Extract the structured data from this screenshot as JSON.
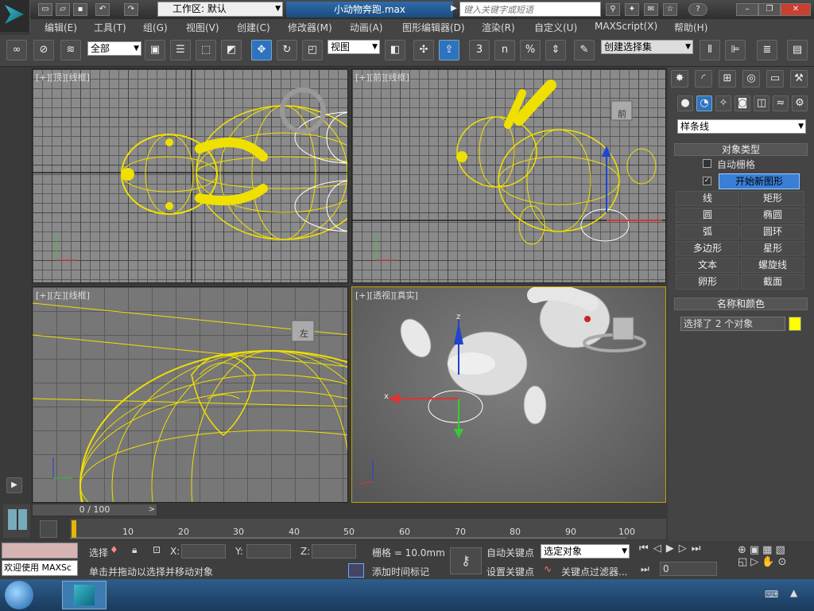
{
  "title_bar": {
    "workspace_label": "工作区: 默认",
    "file_title": "小动物奔跑.max",
    "search_placeholder": "键入关键字或短语",
    "help_icon": "?"
  },
  "menu": [
    "编辑(E)",
    "工具(T)",
    "组(G)",
    "视图(V)",
    "创建(C)",
    "修改器(M)",
    "动画(A)",
    "图形编辑器(D)",
    "渲染(R)",
    "自定义(U)",
    "MAXScript(X)",
    "帮助(H)"
  ],
  "toolbar": {
    "selection_filter": "全部",
    "reference_coord": "视图",
    "named_selection": "创建选择集",
    "snap_value": "3",
    "percent_label": "%",
    "angle_label": "n"
  },
  "viewports": [
    {
      "label": "[+][顶][线框]"
    },
    {
      "label": "[+][前][线框]"
    },
    {
      "label": "[+][左][线框]"
    },
    {
      "label": "[+][透视][真实]"
    }
  ],
  "viewcube_labels": {
    "front": "前",
    "left": "左"
  },
  "command_panel": {
    "category": "样条线",
    "object_type_title": "对象类型",
    "auto_grid": "自动栅格",
    "start_new_shape": "开始新图形",
    "buttons": [
      "线",
      "矩形",
      "圆",
      "椭圆",
      "弧",
      "圆环",
      "多边形",
      "星形",
      "文本",
      "螺旋线",
      "卵形",
      "截面"
    ],
    "name_color_title": "名称和颜色",
    "selection_text": "选择了 2 个对象",
    "object_color": "#ffff00"
  },
  "time": {
    "slider": "0 / 100",
    "ticks": [
      "10",
      "20",
      "30",
      "40",
      "50",
      "60",
      "70",
      "80",
      "90",
      "100"
    ]
  },
  "status": {
    "welcome": "欢迎使用 MAXSc",
    "select_label": "选择",
    "x_label": "X:",
    "y_label": "Y:",
    "z_label": "Z:",
    "grid": "栅格 = 10.0mm",
    "prompt": "单击并拖动以选择并移动对象",
    "add_time_tag": "添加时间标记",
    "auto_key": "自动关键点",
    "set_key": "设置关键点",
    "key_mode": "选定对象",
    "key_filters": "关键点过滤器...",
    "frame": "0"
  },
  "axis_labels": {
    "x": "x",
    "y": "y",
    "z": "z"
  },
  "colors": {
    "wire": "#f0e000",
    "accent": "#2f73c0"
  }
}
